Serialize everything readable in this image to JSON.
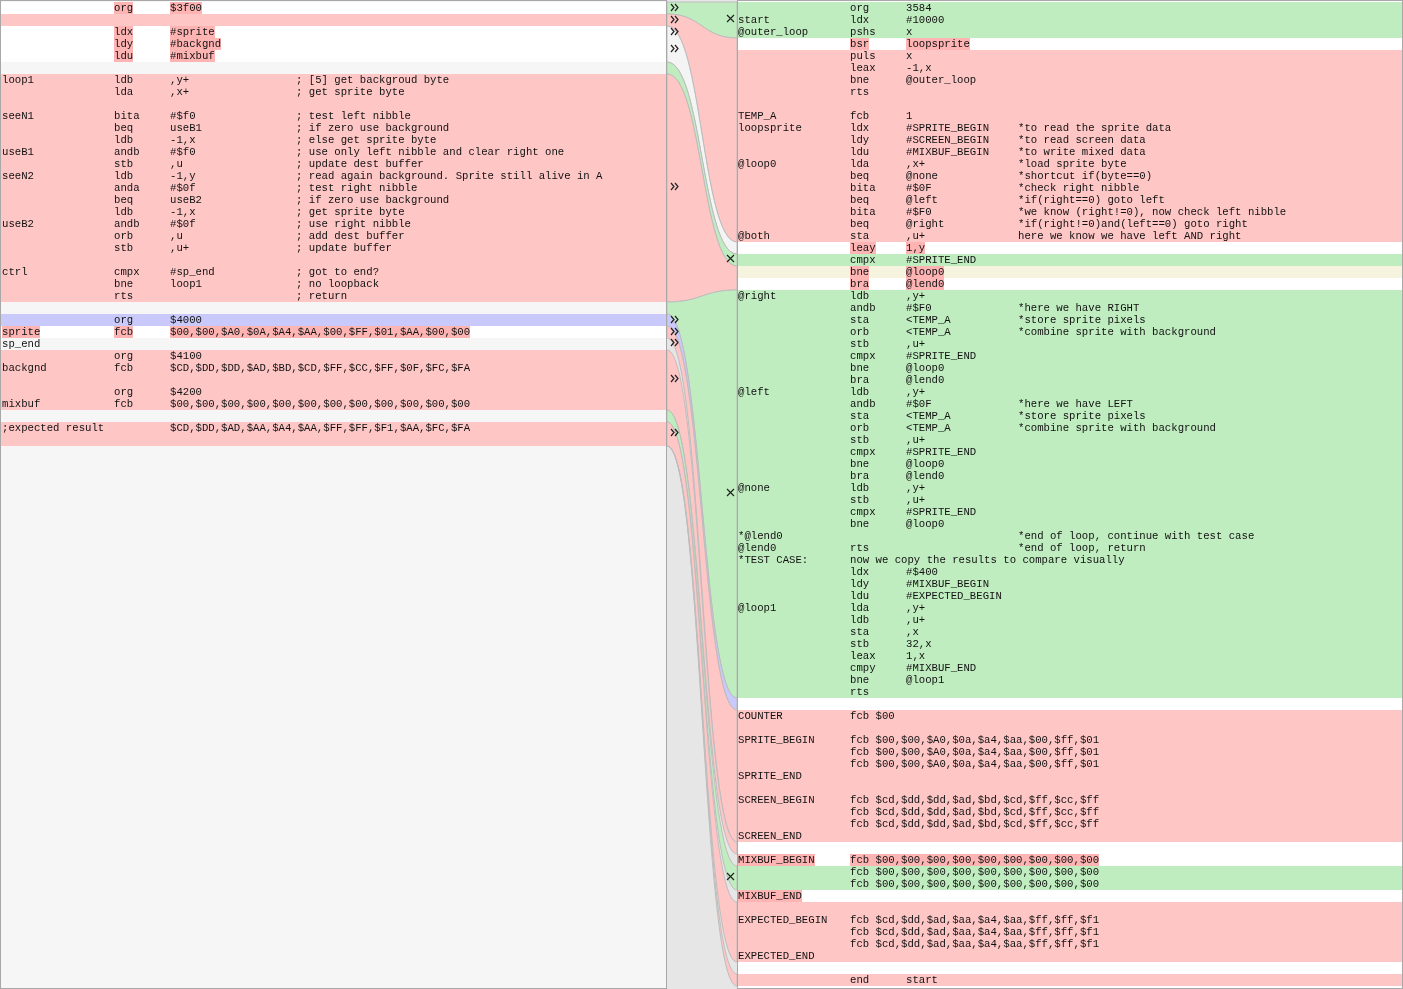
{
  "left_pane": {
    "lines": [
      {
        "kind": "edited",
        "op": "org",
        "arg": "$3f00"
      },
      {
        "kind": "delete"
      },
      {
        "kind": "edited",
        "op": "ldx",
        "arg": "#sprite"
      },
      {
        "kind": "edited",
        "op": "ldy",
        "arg": "#backgnd"
      },
      {
        "kind": "edited",
        "op": "ldu",
        "arg": "#mixbuf"
      },
      {
        "kind": "equal"
      },
      {
        "kind": "delete",
        "label": "loop1",
        "op": "ldb",
        "arg": ",y+",
        "comment": "; [5] get backgroud byte"
      },
      {
        "kind": "delete",
        "op": "lda",
        "arg": ",x+",
        "comment": "; get sprite byte"
      },
      {
        "kind": "delete"
      },
      {
        "kind": "delete",
        "label": "seeN1",
        "op": "bita",
        "arg": "#$f0",
        "comment": "; test left nibble"
      },
      {
        "kind": "delete",
        "op": "beq",
        "arg": "useB1",
        "comment": "; if zero use background"
      },
      {
        "kind": "delete",
        "op": "ldb",
        "arg": "-1,x",
        "comment": "; else get sprite byte"
      },
      {
        "kind": "delete",
        "label": "useB1",
        "op": "andb",
        "arg": "#$f0",
        "comment": "; use only left nibble and clear right one"
      },
      {
        "kind": "delete",
        "op": "stb",
        "arg": ",u",
        "comment": "; update dest buffer"
      },
      {
        "kind": "delete",
        "label": "seeN2",
        "op": "ldb",
        "arg": "-1,y",
        "comment": "; read again background. Sprite still alive in A"
      },
      {
        "kind": "delete",
        "op": "anda",
        "arg": "#$0f",
        "comment": "; test right nibble"
      },
      {
        "kind": "delete",
        "op": "beq",
        "arg": "useB2",
        "comment": "; if zero use background"
      },
      {
        "kind": "delete",
        "op": "ldb",
        "arg": "-1,x",
        "comment": "; get sprite byte"
      },
      {
        "kind": "delete",
        "label": "useB2",
        "op": "andb",
        "arg": "#$0f",
        "comment": "; use right nibble"
      },
      {
        "kind": "delete",
        "op": "orb",
        "arg": ",u",
        "comment": "; add dest buffer"
      },
      {
        "kind": "delete",
        "op": "stb",
        "arg": ",u+",
        "comment": "; update buffer"
      },
      {
        "kind": "delete"
      },
      {
        "kind": "delete",
        "label": "ctrl",
        "op": "cmpx",
        "arg": "#sp_end",
        "comment": "; got to end?"
      },
      {
        "kind": "delete",
        "op": "bne",
        "arg": "loop1",
        "comment": "; no loopback"
      },
      {
        "kind": "delete",
        "op": "rts",
        "comment": "; return"
      },
      {
        "kind": "equal"
      },
      {
        "kind": "change",
        "op": "org",
        "arg": "$4000"
      },
      {
        "kind": "edited",
        "label": "sprite",
        "op": "fcb",
        "arg": "$00,$00,$A0,$0A,$A4,$AA,$00,$FF,$01,$AA,$00,$00"
      },
      {
        "kind": "equal",
        "label": "sp_end"
      },
      {
        "kind": "delete",
        "op": "org",
        "arg": "$4100"
      },
      {
        "kind": "delete",
        "label": "backgnd",
        "op": "fcb",
        "arg": "$CD,$DD,$DD,$AD,$BD,$CD,$FF,$CC,$FF,$0F,$FC,$FA"
      },
      {
        "kind": "delete"
      },
      {
        "kind": "delete",
        "op": "org",
        "arg": "$4200"
      },
      {
        "kind": "delete",
        "label": "mixbuf",
        "op": "fcb",
        "arg": "$00,$00,$00,$00,$00,$00,$00,$00,$00,$00,$00,$00"
      },
      {
        "kind": "equal"
      },
      {
        "kind": "delete",
        "label": ";expected result",
        "arg": "$CD,$DD,$AD,$AA,$A4,$AA,$FF,$FF,$F1,$AA,$FC,$FA"
      },
      {
        "kind": "delete"
      }
    ]
  },
  "right_pane": {
    "lines": [
      {
        "kind": "insert",
        "op": "org",
        "arg": "3584"
      },
      {
        "kind": "insert",
        "label": "start",
        "op": "ldx",
        "arg": "#10000"
      },
      {
        "kind": "insert",
        "label": "@outer_loop",
        "op": "pshs",
        "arg": "x"
      },
      {
        "kind": "edited",
        "op": "bsr",
        "arg": "loopsprite"
      },
      {
        "kind": "delete",
        "op": "puls",
        "arg": "x"
      },
      {
        "kind": "delete",
        "op": "leax",
        "arg": "-1,x"
      },
      {
        "kind": "delete",
        "op": "bne",
        "arg": "@outer_loop"
      },
      {
        "kind": "delete",
        "op": "rts"
      },
      {
        "kind": "delete"
      },
      {
        "kind": "delete",
        "label": "TEMP_A",
        "op": "fcb",
        "arg": "1"
      },
      {
        "kind": "delete",
        "label": "loopsprite",
        "op": "ldx",
        "arg": "#SPRITE_BEGIN",
        "comment": "*to read the sprite data"
      },
      {
        "kind": "delete",
        "op": "ldy",
        "arg": "#SCREEN_BEGIN",
        "comment": "*to read screen data"
      },
      {
        "kind": "delete",
        "op": "ldu",
        "arg": "#MIXBUF_BEGIN",
        "comment": "*to write mixed data"
      },
      {
        "kind": "delete",
        "label": "@loop0",
        "op": "lda",
        "arg": ",x+",
        "comment": "*load sprite byte"
      },
      {
        "kind": "delete",
        "op": "beq",
        "arg": "@none",
        "comment": "*shortcut if(byte==0)"
      },
      {
        "kind": "delete",
        "op": "bita",
        "arg": "#$0F",
        "comment": "*check right nibble"
      },
      {
        "kind": "delete",
        "op": "beq",
        "arg": "@left",
        "comment": "*if(right==0) goto left"
      },
      {
        "kind": "delete",
        "op": "bita",
        "arg": "#$F0",
        "comment": "*we know (right!=0), now check left nibble"
      },
      {
        "kind": "delete",
        "op": "beq",
        "arg": "@right",
        "comment": "*if(right!=0)and(left==0) goto right"
      },
      {
        "kind": "delete",
        "label": "@both",
        "op": "sta",
        "arg": ",u+",
        "comment": "here we know we have left AND right"
      },
      {
        "kind": "edited",
        "op": "leay",
        "arg": "1,y"
      },
      {
        "kind": "insert",
        "op": "cmpx",
        "arg": "#SPRITE_END"
      },
      {
        "kind": "edited-moved",
        "op": "bne",
        "arg": "@loop0"
      },
      {
        "kind": "edited",
        "op": "bra",
        "arg": "@lend0"
      },
      {
        "kind": "insert",
        "label": "@right",
        "op": "ldb",
        "arg": ",y+"
      },
      {
        "kind": "insert",
        "op": "andb",
        "arg": "#$F0",
        "comment": "*here we have RIGHT"
      },
      {
        "kind": "insert",
        "op": "sta",
        "arg": "<TEMP_A",
        "comment": "*store sprite pixels"
      },
      {
        "kind": "insert",
        "op": "orb",
        "arg": "<TEMP_A",
        "comment": "*combine sprite with background"
      },
      {
        "kind": "insert",
        "op": "stb",
        "arg": ",u+"
      },
      {
        "kind": "insert",
        "op": "cmpx",
        "arg": "#SPRITE_END"
      },
      {
        "kind": "insert",
        "op": "bne",
        "arg": "@loop0"
      },
      {
        "kind": "insert",
        "op": "bra",
        "arg": "@lend0"
      },
      {
        "kind": "insert",
        "label": "@left",
        "op": "ldb",
        "arg": ",y+"
      },
      {
        "kind": "insert",
        "op": "andb",
        "arg": "#$0F",
        "comment": "*here we have LEFT"
      },
      {
        "kind": "insert",
        "op": "sta",
        "arg": "<TEMP_A",
        "comment": "*store sprite pixels"
      },
      {
        "kind": "insert",
        "op": "orb",
        "arg": "<TEMP_A",
        "comment": "*combine sprite with background"
      },
      {
        "kind": "insert",
        "op": "stb",
        "arg": ",u+"
      },
      {
        "kind": "insert",
        "op": "cmpx",
        "arg": "#SPRITE_END"
      },
      {
        "kind": "insert",
        "op": "bne",
        "arg": "@loop0"
      },
      {
        "kind": "insert",
        "op": "bra",
        "arg": "@lend0"
      },
      {
        "kind": "insert",
        "label": "@none",
        "op": "ldb",
        "arg": ",y+"
      },
      {
        "kind": "insert",
        "op": "stb",
        "arg": ",u+"
      },
      {
        "kind": "insert",
        "op": "cmpx",
        "arg": "#SPRITE_END"
      },
      {
        "kind": "insert",
        "op": "bne",
        "arg": "@loop0"
      },
      {
        "kind": "insert",
        "label": "*@lend0",
        "comment": "*end of loop, continue with test case"
      },
      {
        "kind": "insert",
        "label": "@lend0",
        "op": "rts",
        "comment": "*end of loop, return"
      },
      {
        "kind": "insert",
        "label": "*TEST CASE:",
        "op": "now we copy the results to compare visually"
      },
      {
        "kind": "insert",
        "op": "ldx",
        "arg": "#$400"
      },
      {
        "kind": "insert",
        "op": "ldy",
        "arg": "#MIXBUF_BEGIN"
      },
      {
        "kind": "insert",
        "op": "ldu",
        "arg": "#EXPECTED_BEGIN"
      },
      {
        "kind": "insert",
        "label": "@loop1",
        "op": "lda",
        "arg": ",y+"
      },
      {
        "kind": "insert",
        "op": "ldb",
        "arg": ",u+"
      },
      {
        "kind": "insert",
        "op": "sta",
        "arg": ",x"
      },
      {
        "kind": "insert",
        "op": "stb",
        "arg": "32,x"
      },
      {
        "kind": "insert",
        "op": "leax",
        "arg": "1,x"
      },
      {
        "kind": "insert",
        "op": "cmpy",
        "arg": "#MIXBUF_END"
      },
      {
        "kind": "insert",
        "op": "bne",
        "arg": "@loop1"
      },
      {
        "kind": "insert",
        "op": "rts"
      },
      {
        "kind": "equal"
      },
      {
        "kind": "delete",
        "label": "COUNTER",
        "op": "fcb $00"
      },
      {
        "kind": "delete"
      },
      {
        "kind": "delete",
        "label": "SPRITE_BEGIN",
        "op": "fcb $00,$00,$A0,$0a,$a4,$aa,$00,$ff,$01"
      },
      {
        "kind": "delete",
        "op": "fcb $00,$00,$A0,$0a,$a4,$aa,$00,$ff,$01"
      },
      {
        "kind": "delete",
        "op": "fcb $00,$00,$A0,$0a,$a4,$aa,$00,$ff,$01"
      },
      {
        "kind": "delete",
        "label": "SPRITE_END"
      },
      {
        "kind": "delete"
      },
      {
        "kind": "delete",
        "label": "SCREEN_BEGIN",
        "op": "fcb $cd,$dd,$dd,$ad,$bd,$cd,$ff,$cc,$ff"
      },
      {
        "kind": "delete",
        "op": "fcb $cd,$dd,$dd,$ad,$bd,$cd,$ff,$cc,$ff"
      },
      {
        "kind": "delete",
        "op": "fcb $cd,$dd,$dd,$ad,$bd,$cd,$ff,$cc,$ff"
      },
      {
        "kind": "delete",
        "label": "SCREEN_END"
      },
      {
        "kind": "equal"
      },
      {
        "kind": "edited",
        "label": "MIXBUF_BEGIN",
        "op": "fcb $00,$00,$00,$00,$00,$00,$00,$00,$00"
      },
      {
        "kind": "insert",
        "op": "fcb $00,$00,$00,$00,$00,$00,$00,$00,$00"
      },
      {
        "kind": "insert",
        "op": "fcb $00,$00,$00,$00,$00,$00,$00,$00,$00"
      },
      {
        "kind": "edited",
        "label": "MIXBUF_END"
      },
      {
        "kind": "delete"
      },
      {
        "kind": "delete",
        "label": "EXPECTED_BEGIN",
        "op": "fcb $cd,$dd,$ad,$aa,$a4,$aa,$ff,$ff,$f1"
      },
      {
        "kind": "delete",
        "op": "fcb $cd,$dd,$ad,$aa,$a4,$aa,$ff,$ff,$f1"
      },
      {
        "kind": "delete",
        "op": "fcb $cd,$dd,$ad,$aa,$a4,$aa,$ff,$ff,$f1"
      },
      {
        "kind": "delete",
        "label": "EXPECTED_END"
      },
      {
        "kind": "equal"
      },
      {
        "kind": "delete",
        "op": "end",
        "arg": "start"
      }
    ]
  }
}
